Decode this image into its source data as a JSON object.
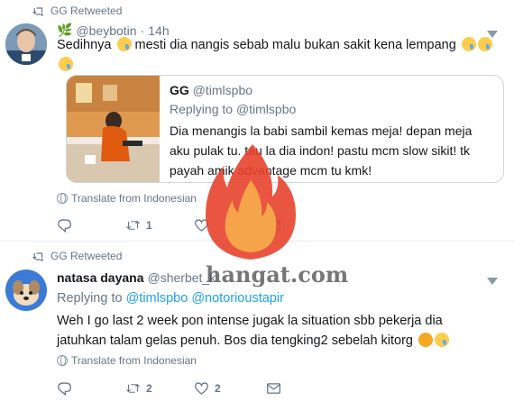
{
  "tweets": [
    {
      "retweet_text": "GG Retweeted",
      "author_name": "",
      "author_prefix": "🌿",
      "handle": "@beybotin",
      "time": "14h",
      "text": "Sedihnya",
      "text_mid": "mesti dia nangis sebab malu bukan sakit kena lempang",
      "quote": {
        "name": "GG",
        "handle": "@timlspbo",
        "replying_label": "Replying to",
        "replying_handle": "@timlspbo",
        "text": "Dia menangis la babi sambil kemas meja! depan meja aku pulak tu. tau la dia indon! pastu mcm slow sikit! tk payah amik advantage mcm tu kmk!"
      },
      "translate_label": "Translate from Indonesian",
      "actions": {
        "reply": "",
        "retweet": "1",
        "like": ""
      }
    },
    {
      "retweet_text": "GG Retweeted",
      "author_name": "natasa dayana",
      "handle": "@sherbet_k",
      "replying_label": "Replying to",
      "replying_handles": "@timlspbo @notorioustapir",
      "text": "Weh I go last 2 week pon intense jugak la situation sbb pekerja dia jatuhkan talam gelas penuh. Bos dia tengking2 sebelah kitorg",
      "translate_label": "Translate from Indonesian",
      "actions": {
        "reply": "",
        "retweet": "2",
        "like": "2"
      }
    }
  ],
  "watermark": {
    "text": "hangat.com",
    "colors": {
      "flame_outer": "#e8432c",
      "flame_inner": "#f7a94a"
    }
  },
  "colors": {
    "accent": "#1da1f2",
    "muted": "#657786",
    "border": "#e6ecf0"
  }
}
